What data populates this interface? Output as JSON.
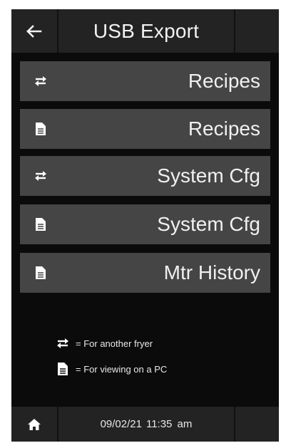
{
  "header": {
    "title": "USB Export",
    "back_icon": "back-arrow-icon"
  },
  "menu": {
    "items": [
      {
        "label": "Recipes",
        "icon": "swap-arrows-icon"
      },
      {
        "label": "Recipes",
        "icon": "document-icon"
      },
      {
        "label": "System Cfg",
        "icon": "swap-arrows-icon"
      },
      {
        "label": "System Cfg",
        "icon": "document-icon"
      },
      {
        "label": "Mtr History",
        "icon": "document-icon"
      }
    ]
  },
  "legend": {
    "swap_text": "= For another fryer",
    "document_text": "= For viewing on a PC"
  },
  "footer": {
    "date": "09/02/21",
    "time": "11:35 am",
    "home_icon": "home-icon"
  },
  "colors": {
    "background": "#0b0b0b",
    "bar": "#232323",
    "button": "#454545",
    "text": "#f2f2f2"
  }
}
